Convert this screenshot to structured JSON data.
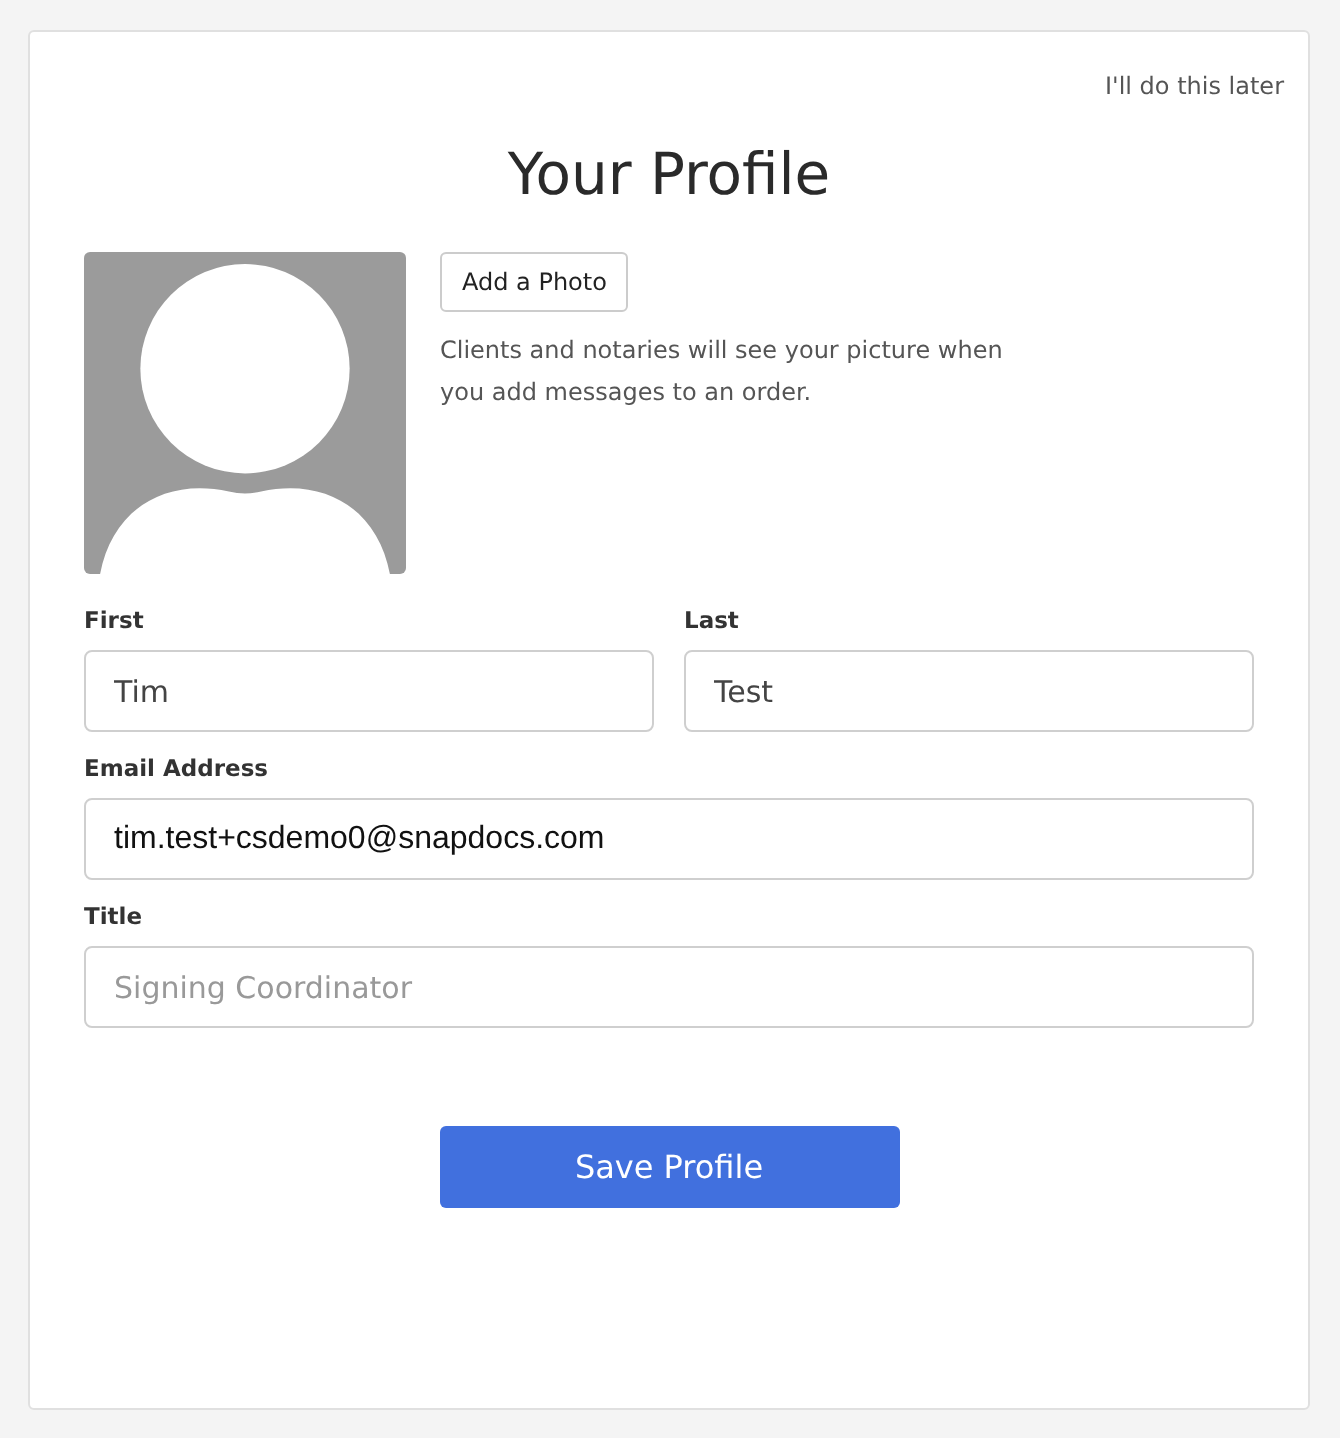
{
  "skip_link": "I'll do this later",
  "title": "Your Profile",
  "photo": {
    "button": "Add a Photo",
    "help": "Clients and notaries will see your picture when you add messages to an order."
  },
  "name_fields": [
    {
      "label": "First",
      "value": "Tim"
    },
    {
      "label": "Last",
      "value": "Test"
    }
  ],
  "fields": [
    {
      "label": "Email Address",
      "value": "tim.test+csdemo0@snapdocs.com",
      "kind": "email"
    },
    {
      "label": "Title",
      "placeholder": "Signing Coordinator",
      "kind": "text"
    }
  ],
  "save_button": "Save Profile"
}
